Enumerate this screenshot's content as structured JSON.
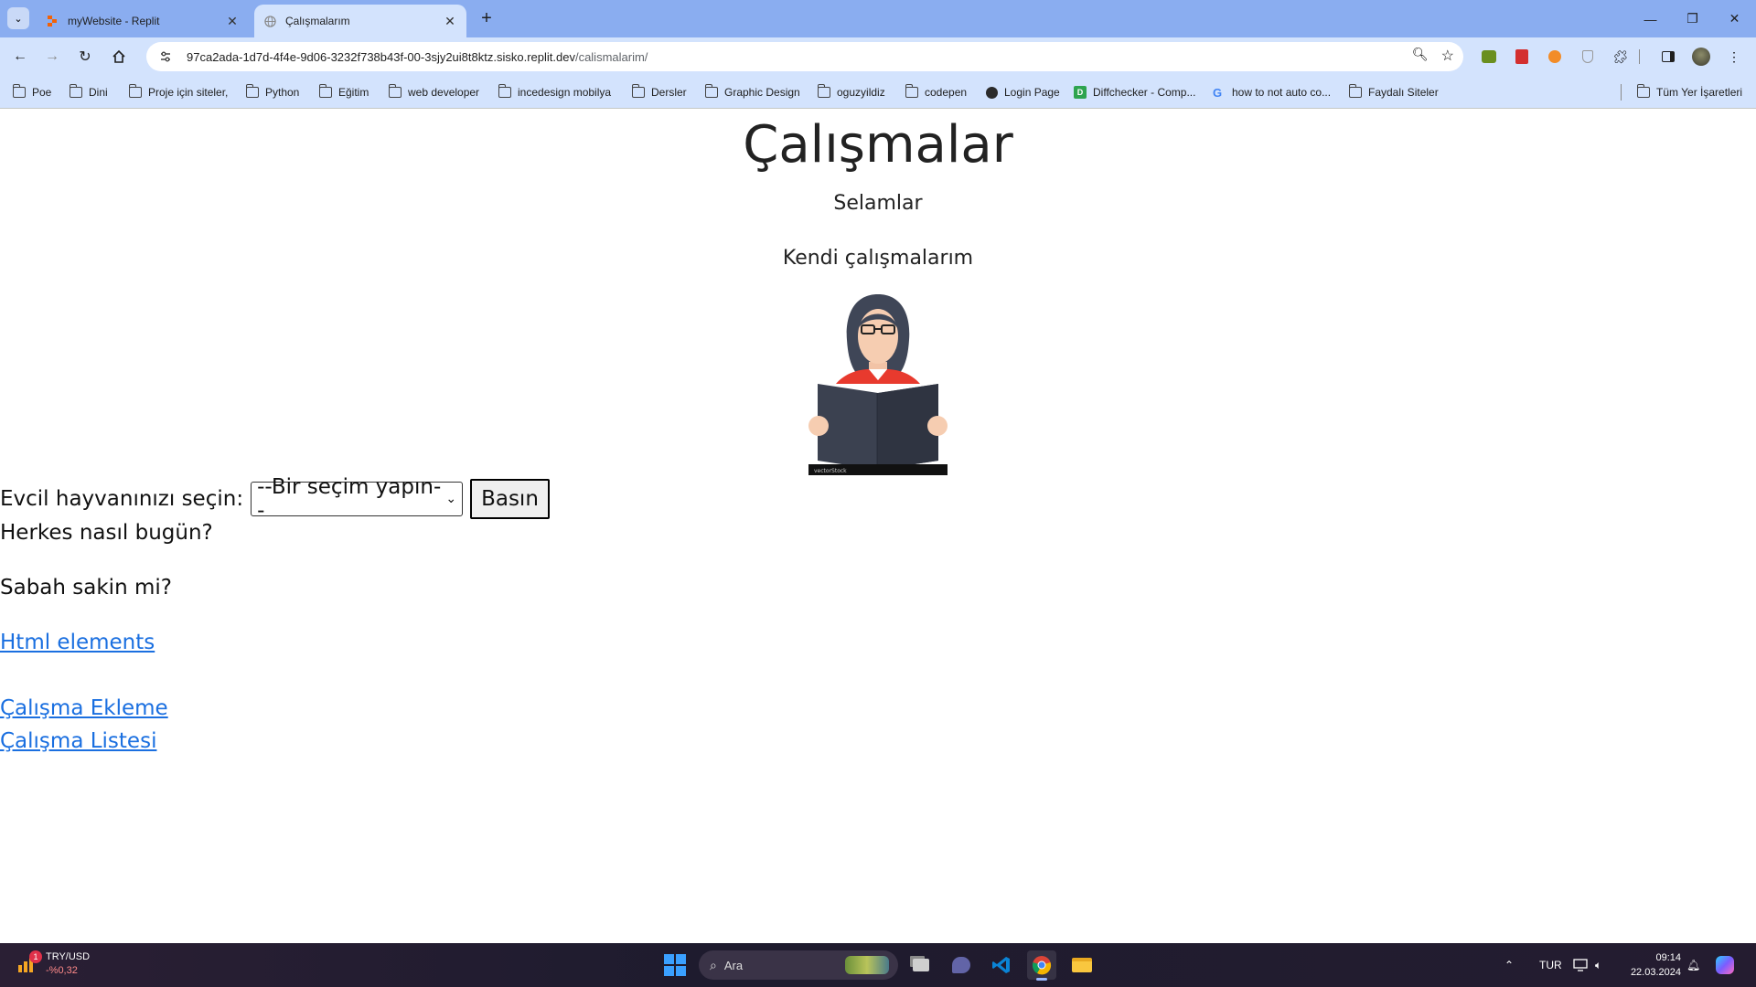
{
  "browser": {
    "tabs": [
      {
        "title": "myWebsite - Replit",
        "active": false,
        "favicon": "replit-icon"
      },
      {
        "title": "Çalışmalarım",
        "active": true,
        "favicon": "globe-icon"
      }
    ],
    "address": {
      "host": "97ca2ada-1d7d-4f4e-9d06-3232f738b43f-00-3sjy2ui8t8ktz.sisko.replit.dev",
      "path": "/calismalarim/"
    },
    "bookmarks": [
      {
        "label": "Poe",
        "icon": "folder-icon"
      },
      {
        "label": "Dini",
        "icon": "folder-icon"
      },
      {
        "label": "Proje için siteler,",
        "icon": "folder-icon"
      },
      {
        "label": "Python",
        "icon": "folder-icon"
      },
      {
        "label": "Eğitim",
        "icon": "folder-icon"
      },
      {
        "label": "web developer",
        "icon": "folder-icon"
      },
      {
        "label": "incedesign mobilya",
        "icon": "folder-icon"
      },
      {
        "label": "Dersler",
        "icon": "folder-icon"
      },
      {
        "label": "Graphic Design",
        "icon": "folder-icon"
      },
      {
        "label": "oguzyildiz",
        "icon": "folder-icon"
      },
      {
        "label": "codepen",
        "icon": "folder-icon"
      },
      {
        "label": "Login Page",
        "icon": "globe-icon"
      },
      {
        "label": "Diffchecker - Comp...",
        "icon": "diffchecker-icon"
      },
      {
        "label": "how to not auto co...",
        "icon": "google-icon"
      },
      {
        "label": "Faydalı Siteler",
        "icon": "folder-icon"
      }
    ],
    "all_bookmarks": "Tüm Yer İşaretleri"
  },
  "page": {
    "heading": "Çalışmalar",
    "greeting": "Selamlar",
    "subtitle": "Kendi çalışmalarım",
    "form": {
      "label": "Evcil hayvanınızı seçin:",
      "select_value": "--Bir seçim yapın--",
      "button": "Basın"
    },
    "line1": "Herkes nasıl bugün?",
    "line2": "Sabah sakin mi?",
    "links": {
      "html_elements": "Html elements",
      "add_work": "Çalışma Ekleme",
      "work_list": "Çalışma Listesi"
    },
    "illustration_brand": "vectorStock"
  },
  "taskbar": {
    "widget": {
      "pair": "TRY/USD",
      "change": "-%0,32",
      "badge": "1"
    },
    "search_placeholder": "Ara",
    "language": "TUR",
    "time": "09:14",
    "date": "22.03.2024"
  },
  "colors": {
    "chrome_tabbar": "#8aadf0",
    "chrome_toolbar": "#d3e3fd",
    "link": "#1a6fe0"
  }
}
